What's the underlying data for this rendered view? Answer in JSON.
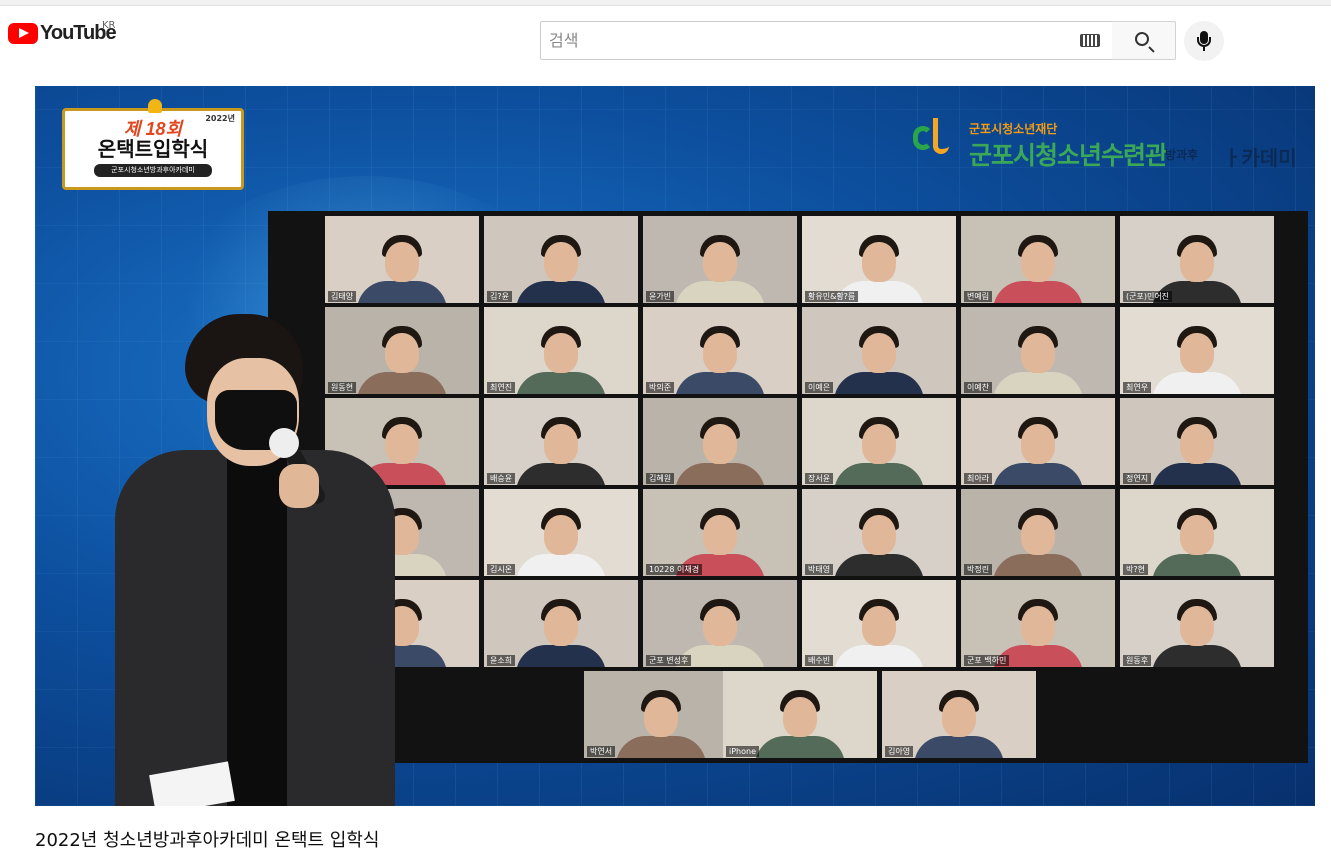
{
  "masthead": {
    "logo_text": "YouTube",
    "country_code": "KR",
    "search_placeholder": "검색",
    "icons": {
      "keyboard": "keyboard-icon",
      "search": "search-icon",
      "mic": "microphone-icon"
    }
  },
  "video": {
    "badge": {
      "year": "2022년",
      "edition": "제 18회",
      "title": "온택트입학식",
      "subtitle": "군포시청소년방과후아카데미"
    },
    "org": {
      "small": "군포시청소년재단",
      "big": "군포시청소년수련관",
      "after_school": "방과후",
      "academy": "ㅏ카데미"
    },
    "participants": [
      [
        "김태양",
        "김?윤",
        "윤가빈",
        "황유민&황?름",
        "변예림",
        "(군포)민어진"
      ],
      [
        "원동현",
        "최연진",
        "박의준",
        "이예은",
        "이예찬",
        "최연우"
      ],
      [
        "",
        "배승윤",
        "김혜원",
        "장서윤",
        "최아라",
        "정연지"
      ],
      [
        "",
        "김시온",
        "10228 이채경",
        "박태영",
        "박정린",
        "박?현"
      ],
      [
        "",
        "윤소희",
        "군포 변성후",
        "배수빈",
        "군포 백하민",
        "원동후"
      ],
      [
        "박연서",
        "iPhone",
        "김아영"
      ]
    ]
  },
  "page": {
    "video_title": "2022년 청소년방과후아카데미 온택트 입학식"
  },
  "colors": {
    "brand_red": "#ff0000",
    "player_blue": "#0d4f9e",
    "org_green": "#3aa856",
    "org_orange": "#f39c12"
  }
}
